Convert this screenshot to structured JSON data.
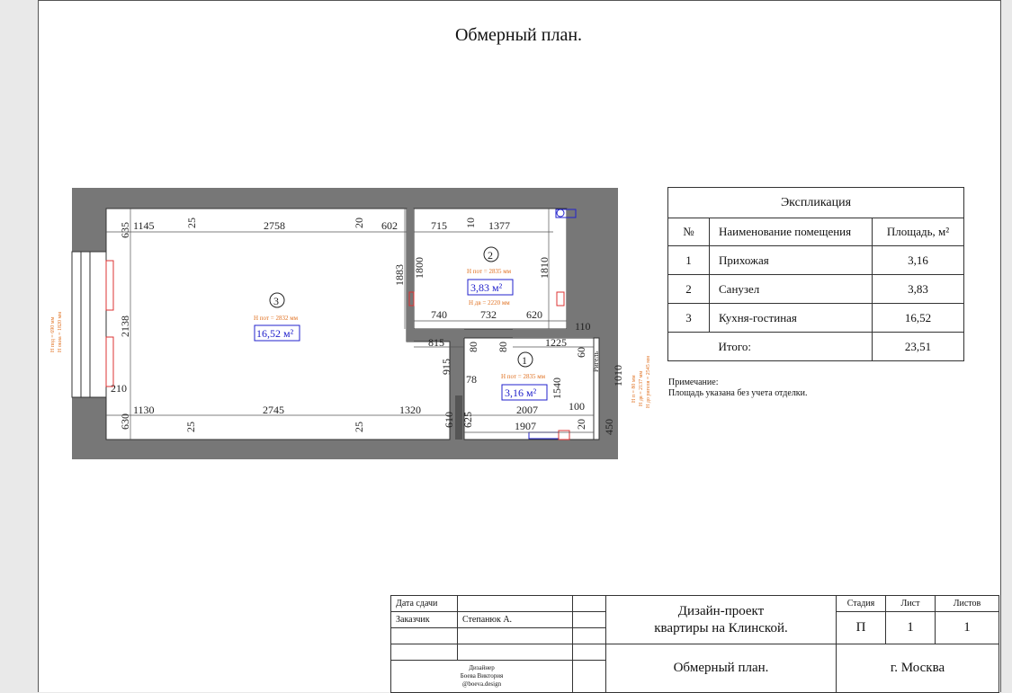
{
  "page": {
    "title": "Обмерный план."
  },
  "explication": {
    "title": "Экспликация",
    "headers": {
      "num": "№",
      "name": "Наименование помещения",
      "area": "Площадь, м²"
    },
    "rows": [
      {
        "num": "1",
        "name": "Прихожая",
        "area": "3,16"
      },
      {
        "num": "2",
        "name": "Санузел",
        "area": "3,83"
      },
      {
        "num": "3",
        "name": "Кухня-гостиная",
        "area": "16,52"
      }
    ],
    "total_label": "Итого:",
    "total_value": "23,51"
  },
  "note": {
    "line1": "Примечание:",
    "line2": "Площадь указана без учета отделки."
  },
  "plan": {
    "rooms": [
      {
        "num": "3",
        "area": "16,52 м²",
        "height": "H пот = 2832 мм"
      },
      {
        "num": "2",
        "area": "3,83 м²",
        "height": "H пот = 2835 мм",
        "door": "H дв = 2220 мм"
      },
      {
        "num": "1",
        "area": "3,16 м²",
        "height": "H пот = 2835 мм"
      }
    ],
    "dims": {
      "d1145": "1145",
      "d25a": "25",
      "d2758": "2758",
      "d20a": "20",
      "d602": "602",
      "d715": "715",
      "d10": "10",
      "d1377": "1377",
      "d635": "635",
      "d2138": "2138",
      "d210": "210",
      "d630": "630",
      "d1883": "1883",
      "d1800": "1800",
      "d1810": "1810",
      "d740": "740",
      "d732": "732",
      "d620": "620",
      "d815": "815",
      "d80a": "80",
      "d80b": "80",
      "d1225": "1225",
      "d110": "110",
      "d60": "60",
      "d915": "915",
      "d78": "78",
      "d1540": "1540",
      "d1010": "1010",
      "d1130": "1130",
      "d25b": "25",
      "d2745": "2745",
      "d25c": "25",
      "d1320": "1320",
      "d610": "610",
      "d625": "625",
      "d2007": "2007",
      "d100": "100",
      "d20b": "20",
      "d1907": "1907",
      "d450": "450"
    },
    "labels": {
      "riser": "Ригель",
      "window_left_1": "H под = 690 мм",
      "window_left_2": "H окна = 1820 мм",
      "right_note_1": "H п = 80 мм",
      "right_note_2": "H дв = 2137 мм",
      "right_note_3": "H до ригеля = 2545 мм"
    }
  },
  "stamp": {
    "date_label": "Дата сдачи",
    "client_label": "Заказчик",
    "client_value": "Степанюк А.",
    "project_line1": "Дизайн-проект",
    "project_line2": "квартиры на Клинской.",
    "stage_label": "Стадия",
    "sheet_label": "Лист",
    "sheets_label": "Листов",
    "stage_value": "П",
    "sheet_value": "1",
    "sheets_value": "1",
    "designer_line1": "Дизайнер",
    "designer_line2": "Боева Виктория",
    "designer_line3": "@boeva.design",
    "drawing_name": "Обмерный план.",
    "city": "г. Москва"
  }
}
